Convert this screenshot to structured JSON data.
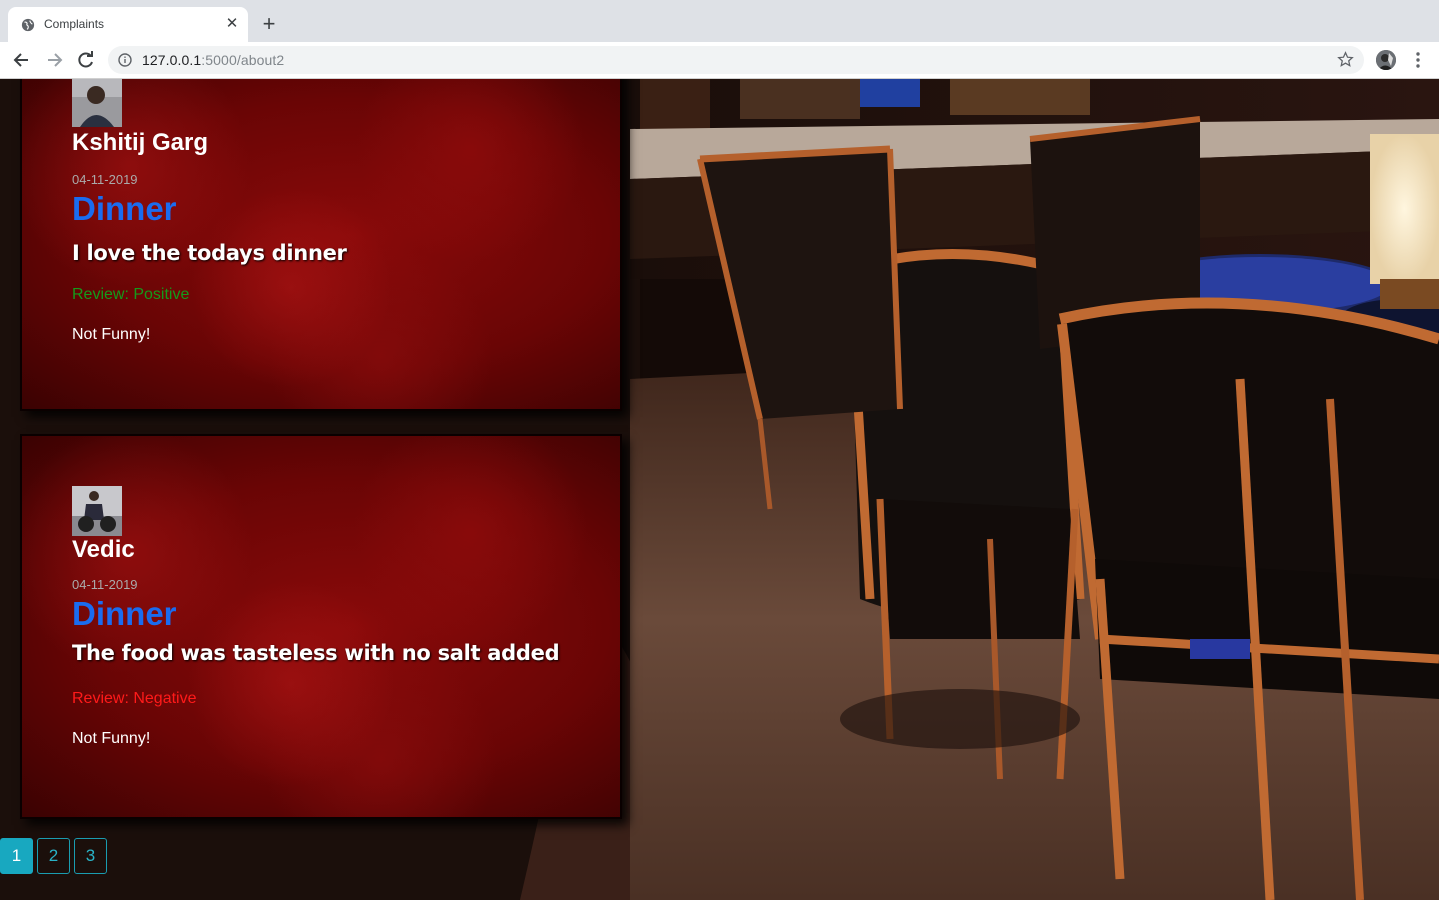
{
  "browser": {
    "tab_title": "Complaints",
    "new_tab_label": "+",
    "close_label": "✕",
    "url_host": "127.0.0.1",
    "url_path": ":5000/about2"
  },
  "complaints": [
    {
      "name": "Kshitij Garg",
      "date": "04-11-2019",
      "subject": "Dinner",
      "text": "I love the todays dinner",
      "review": "Review: Positive",
      "funny": "Not Funny!",
      "review_color": "#159a1a"
    },
    {
      "name": "Vedic",
      "date": "04-11-2019",
      "subject": "Dinner",
      "text": "The food was tasteless with no salt added",
      "review": "Review: Negative",
      "funny": "Not Funny!",
      "review_color": "#ff1a1a"
    }
  ],
  "pagination": {
    "pages": [
      "1",
      "2",
      "3"
    ],
    "active": "1"
  },
  "colors": {
    "subject_blue": "#1a6cf0",
    "pagination_accent": "#18a8c0"
  }
}
